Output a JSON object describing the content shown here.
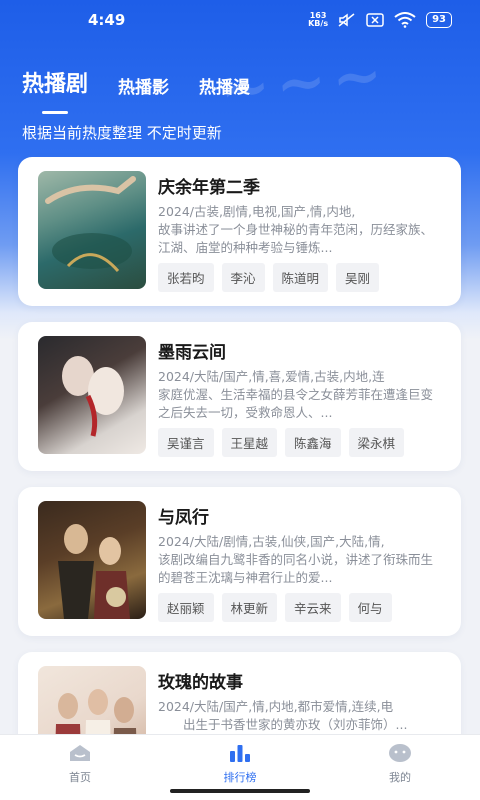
{
  "status_bar": {
    "time": "4:49",
    "net_speed_value": "163",
    "net_speed_unit": "KB/s",
    "battery": "93"
  },
  "tabs": [
    {
      "label": "热播剧",
      "active": true
    },
    {
      "label": "热播影",
      "active": false
    },
    {
      "label": "热播漫",
      "active": false
    }
  ],
  "subtitle": "根据当前热度整理 不定时更新",
  "items": [
    {
      "title": "庆余年第二季",
      "meta": "2024/古装,剧情,电视,国产,情,内地,",
      "desc": "故事讲述了一个身世神秘的青年范闲，历经家族、江湖、庙堂的种种考验与锤炼...",
      "actors": [
        "张若昀",
        "李沁",
        "陈道明",
        "吴刚"
      ]
    },
    {
      "title": "墨雨云间",
      "meta": "2024/大陆/国产,情,喜,爱情,古装,内地,连",
      "desc": "家庭优渥、生活幸福的县令之女薛芳菲在遭逢巨变之后失去一切，受救命恩人、...",
      "actors": [
        "吴谨言",
        "王星越",
        "陈鑫海",
        "梁永棋"
      ]
    },
    {
      "title": "与凤行",
      "meta": "2024/大陆/剧情,古装,仙侠,国产,大陆,情,",
      "desc": "该剧改编自九鹭非香的同名小说，讲述了衔珠而生的碧苍王沈璃与神君行止的爱...",
      "actors": [
        "赵丽颖",
        "林更新",
        "辛云来",
        "何与"
      ]
    },
    {
      "title": "玫瑰的故事",
      "meta": "2024/大陆/国产,情,内地,都市爱情,连续,电",
      "desc": "　　出生于书香世家的黄亦玫（刘亦菲饰）...",
      "actors": []
    }
  ],
  "bottom_nav": [
    {
      "label": "首页",
      "icon": "home-icon",
      "active": false
    },
    {
      "label": "排行榜",
      "icon": "ranking-icon",
      "active": true
    },
    {
      "label": "我的",
      "icon": "profile-icon",
      "active": false
    }
  ],
  "colors": {
    "accent": "#2f6ff0",
    "header_blue": "#1e5ee8",
    "background": "#f0f2f7"
  }
}
